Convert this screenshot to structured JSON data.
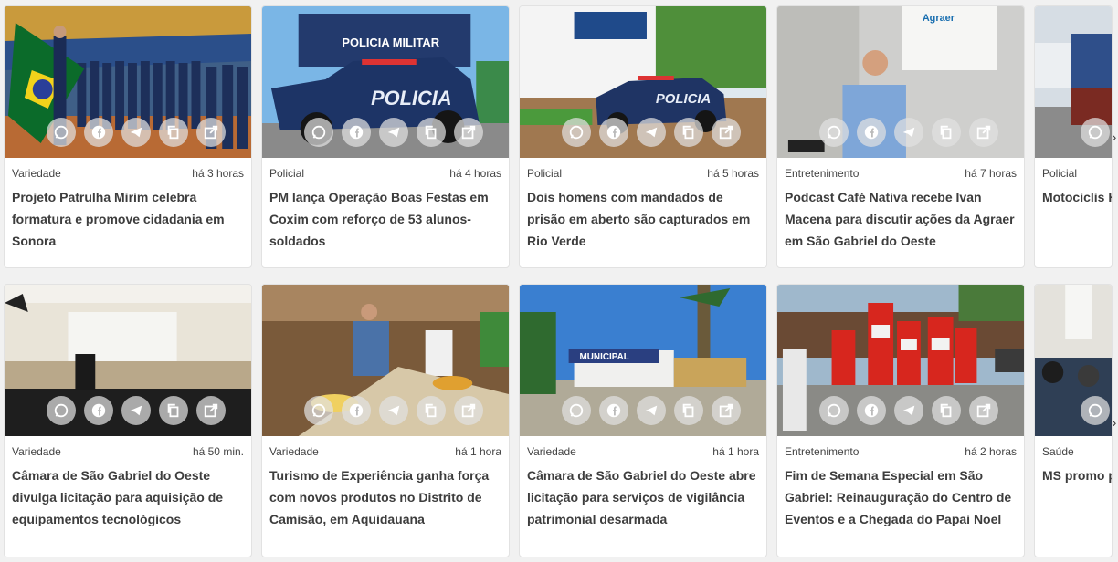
{
  "colors": {
    "accent": "#1e88e5",
    "text": "#3d3d3d",
    "meta": "#444444",
    "card_bg": "#ffffff",
    "page_bg": "#f1f1f1"
  },
  "share_icons": [
    "whatsapp-icon",
    "facebook-icon",
    "telegram-icon",
    "copy-link-icon",
    "open-external-icon"
  ],
  "carousel_arrow": "›",
  "row1": [
    {
      "category": "Variedade",
      "time": "há 3 horas",
      "title": "Projeto Patrulha Mirim celebra formatura e promove cidadania em Sonora",
      "image": "cadets-flag-ceremony-photo"
    },
    {
      "category": "Policial",
      "time": "há 4 horas",
      "title": "PM lança Operação Boas Festas em Coxim com reforço de 53 alunos-soldados",
      "image": "police-truck-photo",
      "image_text": [
        "POLICIA MILITAR",
        "POLICIA"
      ]
    },
    {
      "category": "Policial",
      "time": "há 5 horas",
      "title": "Dois homens com mandados de prisão em aberto são capturados em Rio Verde",
      "image": "police-station-truck-photo",
      "image_text": [
        "POLICIA"
      ]
    },
    {
      "category": "Entretenimento",
      "time": "há 7 horas",
      "title": "Podcast Café Nativa recebe Ivan Macena para discutir ações da Agraer em São Gabriel do Oeste",
      "image": "podcast-guest-photo",
      "image_text": [
        "Agraer"
      ]
    },
    {
      "category": "Policial",
      "time": "",
      "title": "Motociclis Hilux em Gabriel do",
      "image": "street-vehicles-photo"
    }
  ],
  "row2": [
    {
      "category": "Variedade",
      "time": "há 50 min.",
      "title": "Câmara de São Gabriel do Oeste divulga licitação para aquisição de equipamentos tecnológicos",
      "image": "council-chamber-photo"
    },
    {
      "category": "Variedade",
      "time": "há 1 hora",
      "title": "Turismo de Experiência ganha força com novos produtos no Distrito de Camisão, em Aquidauana",
      "image": "food-tasting-photo"
    },
    {
      "category": "Variedade",
      "time": "há 1 hora",
      "title": "Câmara de São Gabriel do Oeste abre licitação para serviços de vigilância patrimonial desarmada",
      "image": "municipal-building-photo",
      "image_text": [
        "MUNICIPAL"
      ]
    },
    {
      "category": "Entretenimento",
      "time": "há 2 horas",
      "title": "Fim de Semana Especial em São Gabriel: Reinauguração do Centro de Eventos e a Chegada do Papai Noel",
      "image": "santa-claus-parade-photo"
    },
    {
      "category": "Saúde",
      "time": "",
      "title": "MS promo profission de Trabalh",
      "image": "health-event-photo"
    }
  ]
}
